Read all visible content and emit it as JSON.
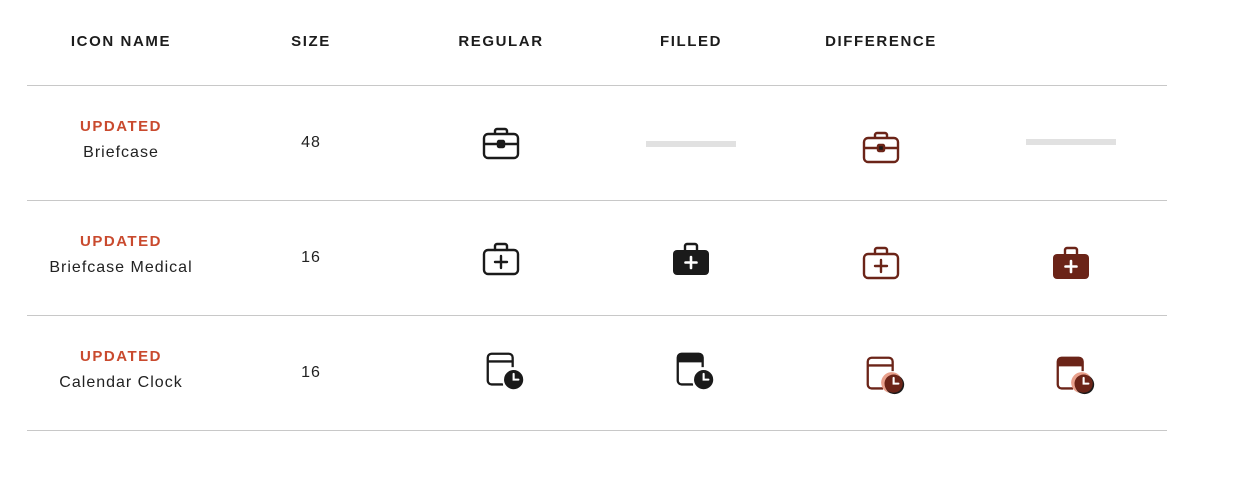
{
  "header": {
    "columns": [
      "ICON NAME",
      "SIZE",
      "REGULAR",
      "FILLED",
      "DIFFERENCE"
    ]
  },
  "rows": [
    {
      "status": "UPDATED",
      "name": "Briefcase",
      "size": "48",
      "icon": "briefcase-icon",
      "has_filled": false
    },
    {
      "status": "UPDATED",
      "name": "Briefcase Medical",
      "size": "16",
      "icon": "briefcase-medical-icon",
      "has_filled": true
    },
    {
      "status": "UPDATED",
      "name": "Calendar Clock",
      "size": "16",
      "icon": "calendar-clock-icon",
      "has_filled": true
    }
  ],
  "colors": {
    "status": "#c94a2e",
    "icon_regular": "#1a1a1a",
    "icon_difference": "#6b2418",
    "difference_clock_highlight": "#e8a08c",
    "divider": "#c8c8c8",
    "placeholder": "#e1e1e1"
  }
}
